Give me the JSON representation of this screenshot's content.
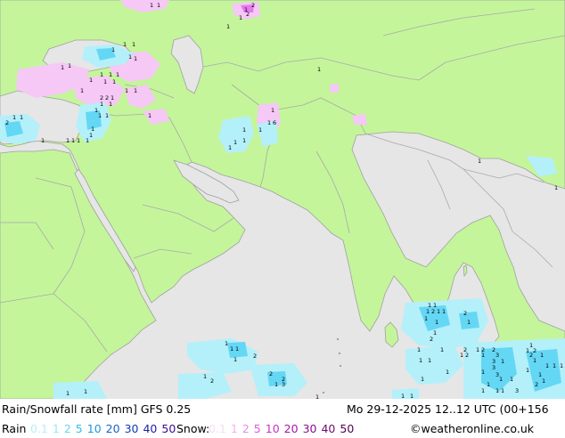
{
  "map": {
    "colors": {
      "sea": "#e6e6e6",
      "land": "#c4f59b",
      "border": "#a9a9a9",
      "coast": "#a0a0a0",
      "rain_light": "#b4f0fa",
      "rain_mod": "#64d7f5",
      "snow_light": "#f5c8f5",
      "snow_mod": "#e678f0"
    },
    "value_label": "1",
    "value_label_2": "2",
    "value_label_3": "3",
    "value_label_6": "6"
  },
  "footer": {
    "title": "Rain/Snowfall rate [mm] GFS 0.25",
    "datetime": "Mo 29-12-2025 12..12 UTC (00+156",
    "rain_label": "Rain",
    "rain_scale": [
      {
        "v": "0.1",
        "color": "#b4f0fa"
      },
      {
        "v": "1",
        "color": "#96e6fa"
      },
      {
        "v": "2",
        "color": "#64d7f5"
      },
      {
        "v": "5",
        "color": "#32bef0"
      },
      {
        "v": "10",
        "color": "#1e96dc"
      },
      {
        "v": "20",
        "color": "#1464c8"
      },
      {
        "v": "30",
        "color": "#0a3cb4"
      },
      {
        "v": "40",
        "color": "#1e1ea0"
      },
      {
        "v": "50",
        "color": "#3c0a8c"
      }
    ],
    "snow_label": "Snow:",
    "snow_scale": [
      {
        "v": "0.1",
        "color": "#f5dcf5"
      },
      {
        "v": "1",
        "color": "#f0b4f0"
      },
      {
        "v": "2",
        "color": "#e68ce6"
      },
      {
        "v": "5",
        "color": "#dc5adc"
      },
      {
        "v": "10",
        "color": "#c832c8"
      },
      {
        "v": "20",
        "color": "#aa14aa"
      },
      {
        "v": "30",
        "color": "#8c0a8c"
      },
      {
        "v": "40",
        "color": "#6e0a6e"
      },
      {
        "v": "50",
        "color": "#500050"
      }
    ],
    "credit": "©weatheronline.co.uk"
  }
}
